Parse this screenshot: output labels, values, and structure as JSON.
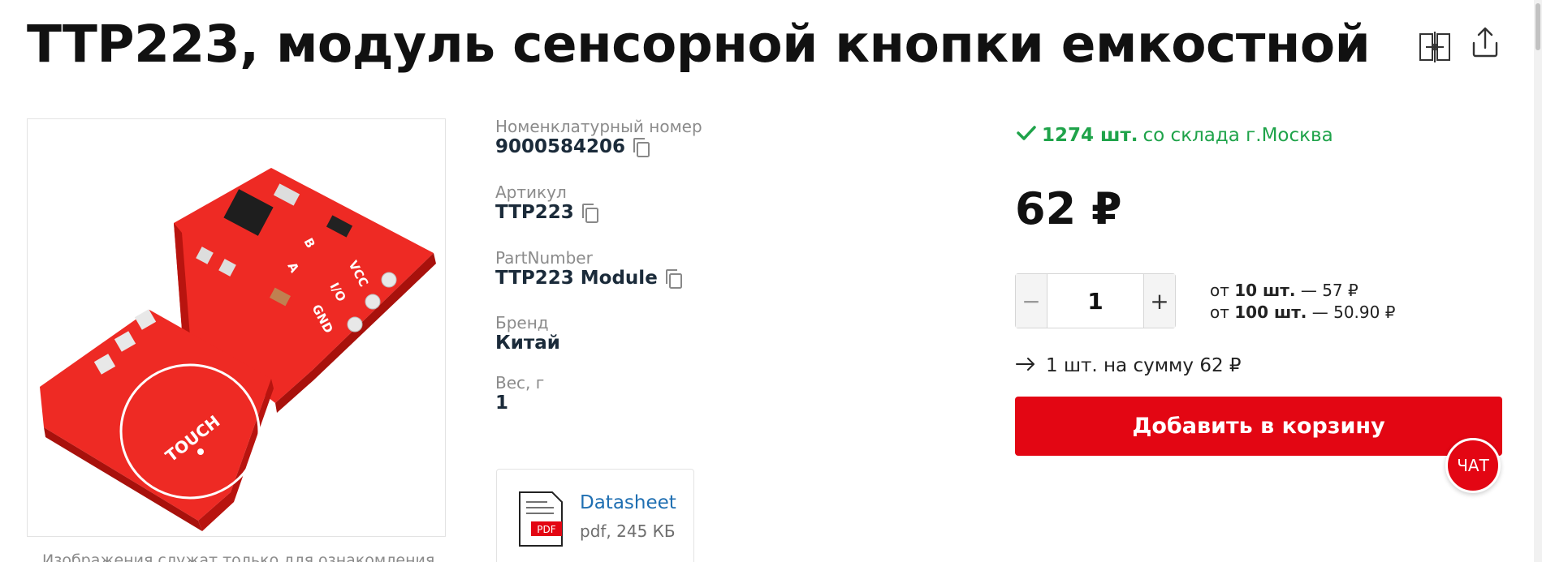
{
  "product": {
    "title": "TTP223, модуль сенсорной кнопки емкостной",
    "image_note": "Изображения служат только для ознакомления"
  },
  "header_icons": {
    "compare": "compare-icon",
    "share": "share-icon"
  },
  "specs": [
    {
      "label": "Номенклатурный номер",
      "value": "9000584206",
      "copyable": true
    },
    {
      "label": "Артикул",
      "value": "TTP223",
      "copyable": true
    },
    {
      "label": "PartNumber",
      "value": "TTP223 Module",
      "copyable": true
    },
    {
      "label": "Бренд",
      "value": "Китай",
      "copyable": false
    },
    {
      "label": "Вес, г",
      "value": "1",
      "copyable": false
    }
  ],
  "document": {
    "badge": "PDF",
    "name": "Datasheet",
    "meta": "pdf, 245 КБ"
  },
  "stock": {
    "count": "1274 шт.",
    "location": "со склада г.Москва"
  },
  "price": "62 ₽",
  "quantity": {
    "minus": "−",
    "value": "1",
    "plus": "+"
  },
  "tiers": [
    {
      "prefix": "от",
      "qty": "10 шт.",
      "price": "— 57 ₽"
    },
    {
      "prefix": "от",
      "qty": "100 шт.",
      "price": "— 50.90 ₽"
    }
  ],
  "total_line": "1 шт. на сумму 62 ₽",
  "add_to_cart": "Добавить в корзину",
  "chat": "ЧАТ",
  "pcb": {
    "touch_label": "TOUCH",
    "pin_labels": [
      "VCC",
      "I/O",
      "GND"
    ],
    "jumper_labels": [
      "A",
      "B"
    ]
  },
  "colors": {
    "accent_red": "#e30613",
    "stock_green": "#1fa34a",
    "link_blue": "#1f6fb2"
  }
}
